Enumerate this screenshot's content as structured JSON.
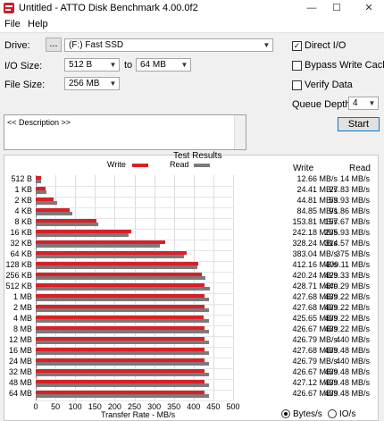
{
  "window": {
    "title": "Untitled - ATTO Disk Benchmark 4.00.0f2",
    "minimize": "—",
    "maximize": "☐",
    "close": "✕"
  },
  "menu": {
    "file": "File",
    "help": "Help"
  },
  "settings": {
    "drive_label": "Drive:",
    "browse_label": "...",
    "drive_value": "(F:) Fast SSD",
    "io_size_label": "I/O Size:",
    "io_from": "512 B",
    "to_label": "to",
    "io_to": "64 MB",
    "file_size_label": "File Size:",
    "file_size": "256 MB",
    "direct_io": "Direct I/O",
    "bypass_write_cache": "Bypass Write Cache",
    "verify_data": "Verify Data",
    "queue_depth_label": "Queue Depth:",
    "queue_depth": "4",
    "start": "Start",
    "description": "<< Description >>",
    "checkmark": "✓"
  },
  "results": {
    "title": "Test Results",
    "write_legend": "Write",
    "read_legend": "Read",
    "write_col": "Write",
    "read_col": "Read",
    "xlabel": "Transfer Rate - MB/s",
    "bytes_per_s": "Bytes/s",
    "io_per_s": "IO/s",
    "colors": {
      "write": "#dc1f26",
      "read": "#7a7a7a"
    }
  },
  "chart_data": {
    "type": "bar",
    "title": "Test Results",
    "xlabel": "Transfer Rate - MB/s",
    "ylabel": "",
    "xlim": [
      0,
      500
    ],
    "xticks": [
      "0",
      "50",
      "100",
      "150",
      "200",
      "250",
      "300",
      "350",
      "400",
      "450",
      "500"
    ],
    "categories": [
      "512 B",
      "1 KB",
      "2 KB",
      "4 KB",
      "8 KB",
      "16 KB",
      "32 KB",
      "64 KB",
      "128 KB",
      "256 KB",
      "512 KB",
      "1 MB",
      "2 MB",
      "4 MB",
      "8 MB",
      "12 MB",
      "16 MB",
      "24 MB",
      "32 MB",
      "48 MB",
      "64 MB"
    ],
    "series": [
      {
        "name": "Write",
        "values": [
          12.66,
          24.41,
          44.81,
          84.85,
          153.81,
          242.18,
          328.24,
          383.04,
          412.16,
          420.24,
          428.71,
          427.68,
          427.68,
          425.65,
          426.67,
          426.79,
          427.68,
          426.79,
          426.67,
          427.12,
          426.67
        ],
        "labels": [
          "12.66 MB/s",
          "24.41 MB/s",
          "44.81 MB/s",
          "84.85 MB/s",
          "153.81 MB/s",
          "242.18 MB/s",
          "328.24 MB/s",
          "383.04 MB/s",
          "412.16 MB/s",
          "420.24 MB/s",
          "428.71 MB/s",
          "427.68 MB/s",
          "427.68 MB/s",
          "425.65 MB/s",
          "426.67 MB/s",
          "426.79 MB/s",
          "427.68 MB/s",
          "426.79 MB/s",
          "426.67 MB/s",
          "427.12 MB/s",
          "426.67 MB/s"
        ]
      },
      {
        "name": "Read",
        "values": [
          14,
          27.83,
          53.93,
          91.86,
          157.67,
          235.93,
          314.57,
          375,
          409.11,
          429.33,
          440.29,
          439.22,
          439.22,
          439.22,
          439.22,
          440,
          439.48,
          440,
          439.48,
          439.48,
          439.48
        ],
        "labels": [
          "14 MB/s",
          "27.83 MB/s",
          "53.93 MB/s",
          "91.86 MB/s",
          "157.67 MB/s",
          "235.93 MB/s",
          "314.57 MB/s",
          "375 MB/s",
          "409.11 MB/s",
          "429.33 MB/s",
          "440.29 MB/s",
          "439.22 MB/s",
          "439.22 MB/s",
          "439.22 MB/s",
          "439.22 MB/s",
          "440 MB/s",
          "439.48 MB/s",
          "440 MB/s",
          "439.48 MB/s",
          "439.48 MB/s",
          "439.48 MB/s"
        ]
      }
    ]
  }
}
